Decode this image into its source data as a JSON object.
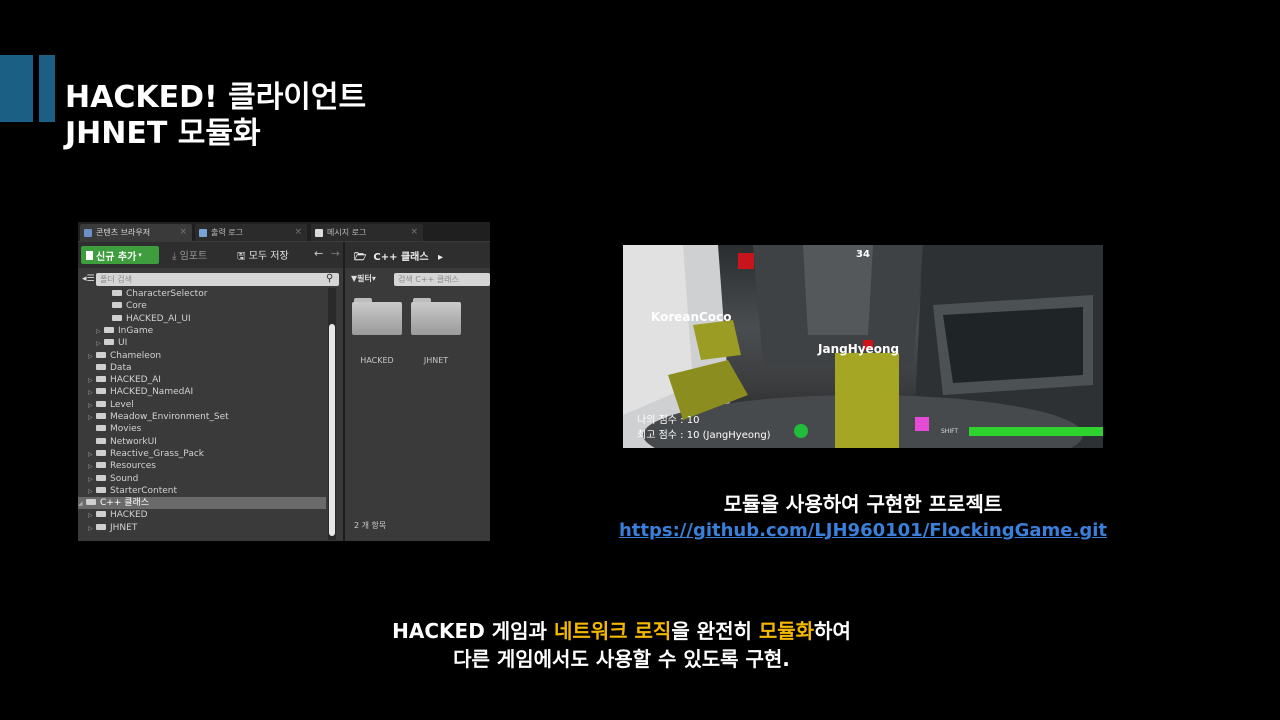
{
  "slide": {
    "title_line1": "HACKED! 클라이언트",
    "title_line2": "JHNET 모듈화",
    "accent_color": "#1c5f85",
    "highlight_color": "#f5b800",
    "link_color": "#3a7fd9"
  },
  "content_browser": {
    "tabs": [
      {
        "label": "콘텐츠 브라우저",
        "icon": "content-browser-icon"
      },
      {
        "label": "출력 로그",
        "icon": "output-log-icon"
      },
      {
        "label": "메시지 로그",
        "icon": "message-log-icon"
      }
    ],
    "toolbar": {
      "add_new": "신규 추가",
      "import": "임포트",
      "save_all": "모두 저장",
      "breadcrumb": "C++ 클래스"
    },
    "folder_search_placeholder": "폴더 검색",
    "filter_label": "필터",
    "asset_search_placeholder": "검색 C++ 클래스",
    "tree": [
      {
        "label": "CharacterSelector",
        "indent": 2,
        "expandable": false
      },
      {
        "label": "Core",
        "indent": 2,
        "expandable": false
      },
      {
        "label": "HACKED_AI_UI",
        "indent": 2,
        "expandable": false
      },
      {
        "label": "InGame",
        "indent": 1,
        "expandable": true
      },
      {
        "label": "UI",
        "indent": 1,
        "expandable": true
      },
      {
        "label": "Chameleon",
        "indent": 0,
        "expandable": true
      },
      {
        "label": "Data",
        "indent": 0,
        "expandable": false
      },
      {
        "label": "HACKED_AI",
        "indent": 0,
        "expandable": true
      },
      {
        "label": "HACKED_NamedAI",
        "indent": 0,
        "expandable": true
      },
      {
        "label": "Level",
        "indent": 0,
        "expandable": true
      },
      {
        "label": "Meadow_Environment_Set",
        "indent": 0,
        "expandable": true
      },
      {
        "label": "Movies",
        "indent": 0,
        "expandable": false
      },
      {
        "label": "NetworkUI",
        "indent": 0,
        "expandable": false
      },
      {
        "label": "Reactive_Grass_Pack",
        "indent": 0,
        "expandable": true
      },
      {
        "label": "Resources",
        "indent": 0,
        "expandable": true
      },
      {
        "label": "Sound",
        "indent": 0,
        "expandable": true
      },
      {
        "label": "StarterContent",
        "indent": 0,
        "expandable": true
      },
      {
        "label": "C++ 클래스",
        "indent": -1,
        "expandable": true,
        "selected": true
      },
      {
        "label": "HACKED",
        "indent": 0,
        "expandable": true
      },
      {
        "label": "JHNET",
        "indent": 0,
        "expandable": true
      }
    ],
    "folders": [
      "HACKED",
      "JHNET"
    ],
    "item_count": "2 개 항목"
  },
  "game": {
    "timer": "34",
    "player1": "KoreanCoco",
    "player2": "JangHyeong",
    "my_score": "나의 점수 : 10",
    "best_score": "최고 점수 : 10 (JangHyeong)",
    "shift_label": "SHIFT",
    "stamina": 1.0
  },
  "caption": "모듈을 사용하여 구현한 프로젝트",
  "link": "https://github.com/LJH960101/FlockingGame.git",
  "summary": {
    "line1_a": "HACKED 게임과 ",
    "line1_hl1": "네트워크 로직",
    "line1_b": "을 완전히 ",
    "line1_hl2": "모듈화",
    "line1_c": "하여",
    "line2": "다른 게임에서도 사용할 수 있도록 구현."
  }
}
